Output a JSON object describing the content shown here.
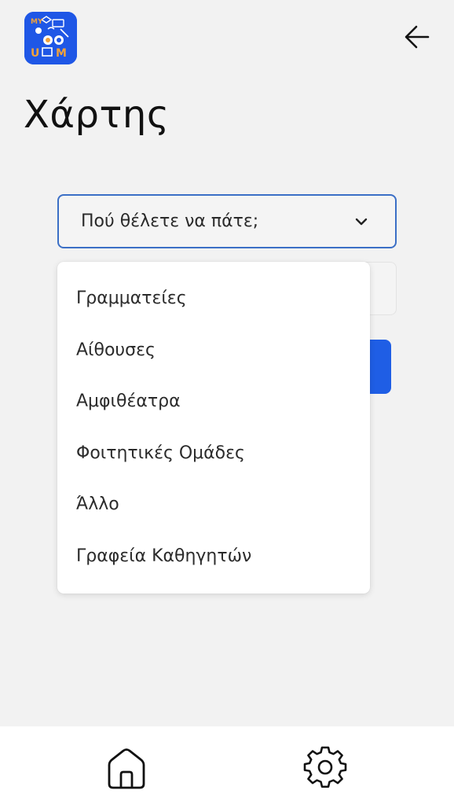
{
  "header": {
    "logo_text": "MY UOM",
    "title": "Χάρτης"
  },
  "icons": {
    "back": "arrow-left-icon",
    "chevron": "chevron-down-icon",
    "home": "home-icon",
    "settings": "gear-icon"
  },
  "dropdown": {
    "placeholder": "Πού θέλετε να πάτε;",
    "options": [
      "Γραμματείες",
      "Αίθουσες",
      "Αμφιθέατρα",
      "Φοιτητικές Ομάδες",
      "Άλλο",
      "Γραφεία Καθηγητών"
    ]
  },
  "colors": {
    "brand_blue": "#1f5ee5",
    "border_blue": "#3b6fc6",
    "logo_orange": "#f2a23a"
  }
}
